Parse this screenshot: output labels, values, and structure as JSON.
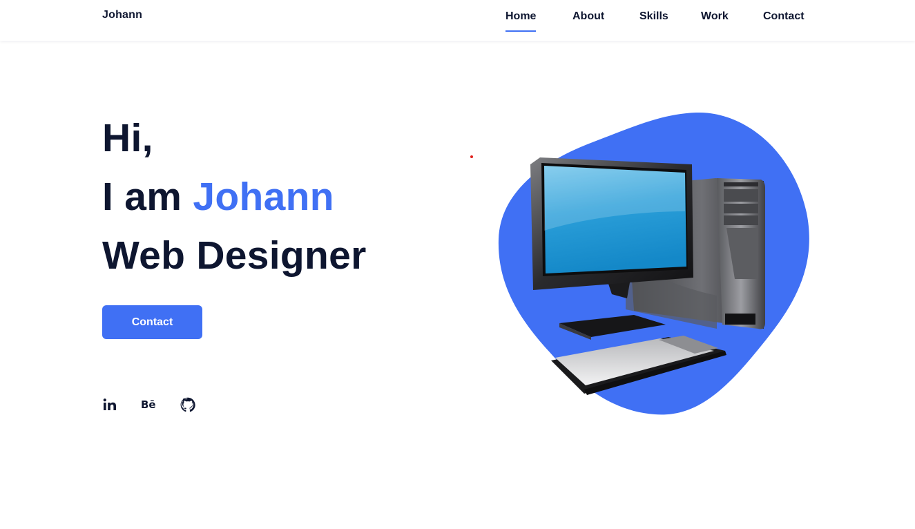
{
  "header": {
    "logo": "Johann",
    "nav": [
      {
        "label": "Home",
        "active": true
      },
      {
        "label": "About",
        "active": false
      },
      {
        "label": "Skills",
        "active": false
      },
      {
        "label": "Work",
        "active": false
      },
      {
        "label": "Contact",
        "active": false
      }
    ]
  },
  "hero": {
    "greeting": "Hi,",
    "intro_prefix": "I am ",
    "name": "Johann",
    "role": "Web Designer",
    "contact_button": "Contact",
    "image": "desktop-computer-illustration"
  },
  "social": [
    {
      "name": "linkedin-icon",
      "glyph": "in"
    },
    {
      "name": "behance-icon",
      "glyph": "Bē"
    },
    {
      "name": "github-icon",
      "glyph": ""
    }
  ],
  "colors": {
    "accent": "#4070f4",
    "text": "#0e1630",
    "background": "#ffffff"
  }
}
